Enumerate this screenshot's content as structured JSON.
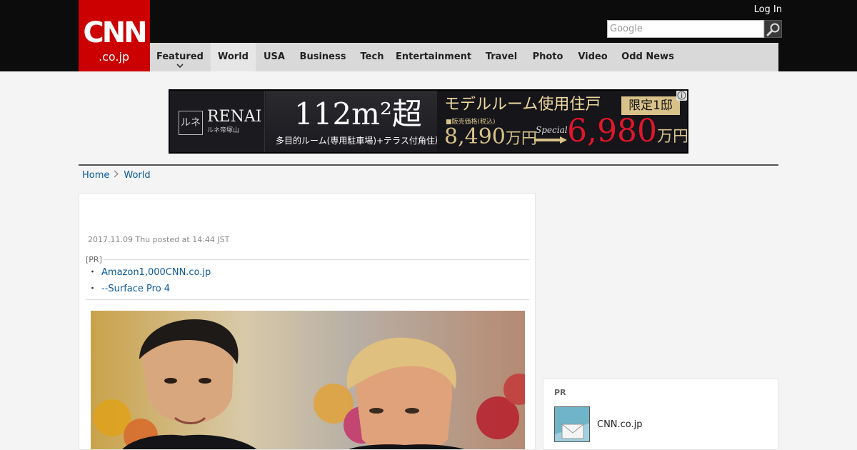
{
  "header": {
    "logo_top": "CNN",
    "logo_bottom": ".co.jp",
    "login_label": "Log In",
    "search_placeholder": "Google"
  },
  "nav": {
    "items": [
      {
        "label": "Featured"
      },
      {
        "label": "World"
      },
      {
        "label": "USA"
      },
      {
        "label": "Business"
      },
      {
        "label": "Tech"
      },
      {
        "label": "Entertainment"
      },
      {
        "label": "Travel"
      },
      {
        "label": "Photo"
      },
      {
        "label": "Video"
      },
      {
        "label": "Odd News"
      }
    ],
    "active": "World"
  },
  "ad": {
    "brand": "RENAI",
    "brand_sub": "ルネ帝塚山",
    "mark": "ルネ",
    "size_text": "112m²超",
    "desc": "多目的ルーム(専用駐車場)+テラス付角住戸",
    "headline": "モデルルーム使用住戸",
    "badge": "限定1邸",
    "price_label": "■販売価格(税込)",
    "old_price": "8,490",
    "unit": "万円",
    "special": "Special",
    "new_price": "6,980"
  },
  "breadcrumb": {
    "home": "Home",
    "section": "World"
  },
  "article": {
    "dateline": "2017.11.09 Thu posted at 14:44 JST",
    "pr_label": "[PR]",
    "pr_links": [
      {
        "bullet": "・",
        "text": "Amazon1,000CNN.co.jp"
      },
      {
        "bullet": "・",
        "text": "--Surface Pro 4"
      }
    ]
  },
  "sidebar_pr": {
    "label": "PR",
    "title": "CNN.co.jp"
  },
  "colors": {
    "brand_red": "#cc0000",
    "topbar": "#0c0c0c",
    "nav_bg": "#d9d9d9",
    "link": "#0a5a9c"
  }
}
